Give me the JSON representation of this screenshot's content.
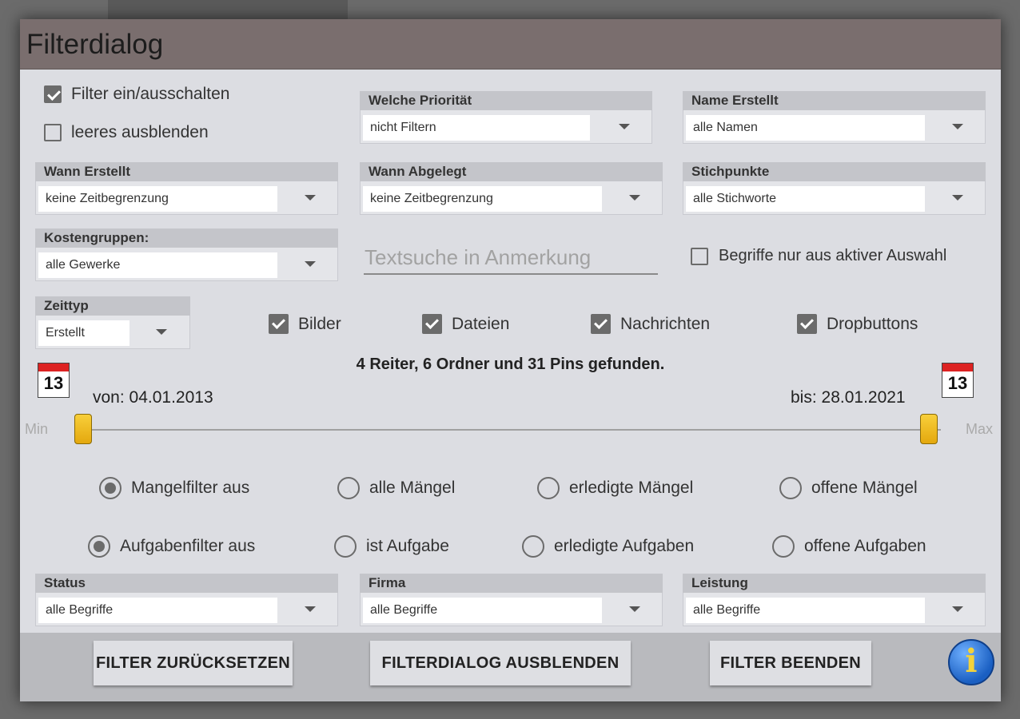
{
  "dialog": {
    "title": "Filterdialog"
  },
  "toggles": {
    "filter_onoff": {
      "label": "Filter ein/ausschalten",
      "checked": true
    },
    "hide_empty": {
      "label": "leeres ausblenden",
      "checked": false
    }
  },
  "groups": {
    "priority": {
      "title": "Welche Priorität",
      "value": "nicht Filtern"
    },
    "name_created": {
      "title": "Name Erstellt",
      "value": "alle Namen"
    },
    "when_created": {
      "title": "Wann Erstellt",
      "value": "keine Zeitbegrenzung"
    },
    "when_filed": {
      "title": "Wann Abgelegt",
      "value": "keine Zeitbegrenzung"
    },
    "keywords": {
      "title": "Stichpunkte",
      "value": "alle Stichworte"
    },
    "cost_groups": {
      "title": "Kostengruppen:",
      "value": "alle Gewerke"
    },
    "time_type": {
      "title": "Zeittyp",
      "value": "Erstellt"
    },
    "status": {
      "title": "Status",
      "value": "alle Begriffe"
    },
    "company": {
      "title": "Firma",
      "value": "alle Begriffe"
    },
    "service": {
      "title": "Leistung",
      "value": "alle Begriffe"
    }
  },
  "search": {
    "placeholder": "Textsuche in Anmerkung"
  },
  "active_only": {
    "label": "Begriffe nur aus aktiver Auswahl",
    "checked": false
  },
  "types": [
    {
      "label": "Bilder",
      "checked": true
    },
    {
      "label": "Dateien",
      "checked": true
    },
    {
      "label": "Nachrichten",
      "checked": true
    },
    {
      "label": "Dropbuttons",
      "checked": true
    }
  ],
  "result_text": "4 Reiter, 6 Ordner und 31 Pins gefunden.",
  "date_range": {
    "calendar_day": "13",
    "from": "von: 04.01.2013",
    "to": "bis: 28.01.2021",
    "min_label": "Min",
    "max_label": "Max",
    "from_position": 0.0,
    "to_position": 1.0
  },
  "defect_filter": [
    {
      "label": "Mangelfilter aus",
      "selected": true
    },
    {
      "label": "alle Mängel",
      "selected": false
    },
    {
      "label": "erledigte Mängel",
      "selected": false
    },
    {
      "label": "offene Mängel",
      "selected": false
    }
  ],
  "task_filter": [
    {
      "label": "Aufgabenfilter aus",
      "selected": true
    },
    {
      "label": "ist Aufgabe",
      "selected": false
    },
    {
      "label": "erledigte Aufgaben",
      "selected": false
    },
    {
      "label": "offene Aufgaben",
      "selected": false
    }
  ],
  "footer": {
    "reset": "FILTER ZURÜCKSETZEN",
    "hide": "FILTERDIALOG AUSBLENDEN",
    "end": "FILTER BEENDEN",
    "info_glyph": "i"
  }
}
